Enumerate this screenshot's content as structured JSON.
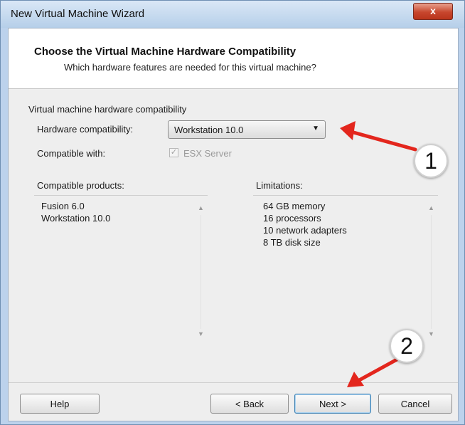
{
  "window": {
    "title": "New Virtual Machine Wizard",
    "close_glyph": "x"
  },
  "header": {
    "title": "Choose the Virtual Machine Hardware Compatibility",
    "subtitle": "Which hardware features are needed for this virtual machine?"
  },
  "form": {
    "group_label": "Virtual machine hardware compatibility",
    "hardware_label": "Hardware compatibility:",
    "hardware_value": "Workstation 10.0",
    "compatible_label": "Compatible with:",
    "compatible_checkbox_label": "ESX Server",
    "compatible_checkbox_checked": true,
    "compatible_checkbox_enabled": false
  },
  "products": {
    "header": "Compatible products:",
    "items": [
      "Fusion 6.0",
      "Workstation 10.0"
    ]
  },
  "limitations": {
    "header": "Limitations:",
    "items": [
      "64 GB memory",
      "16 processors",
      "10 network adapters",
      "8 TB disk size"
    ]
  },
  "buttons": {
    "help": "Help",
    "back": "< Back",
    "next": "Next >",
    "cancel": "Cancel"
  },
  "annotations": {
    "callout_1": "1",
    "callout_2": "2",
    "arrow_color": "#e3261d"
  }
}
